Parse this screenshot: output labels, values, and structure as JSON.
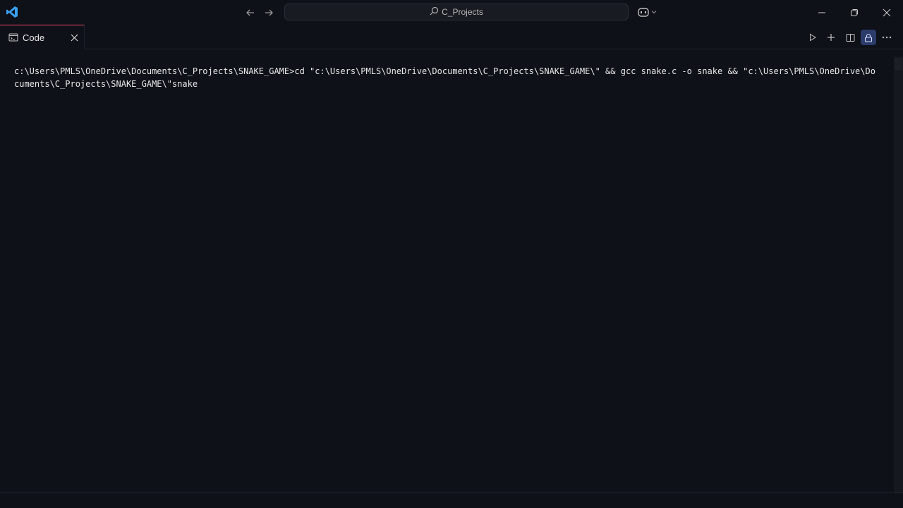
{
  "titlebar": {
    "search_text": "C_Projects",
    "icons": [
      "vscode-logo-icon",
      "arrow-left-icon",
      "arrow-right-icon",
      "search-icon",
      "copilot-icon",
      "minimize-icon",
      "restore-icon",
      "close-icon"
    ]
  },
  "tab": {
    "label": "Code",
    "icon": "terminal-icon"
  },
  "actions": [
    "run-icon",
    "plus-icon",
    "split-icon",
    "lock-icon",
    "ellipsis-icon"
  ],
  "terminal": {
    "line1": "c:\\Users\\PMLS\\OneDrive\\Documents\\C_Projects\\SNAKE_GAME>cd \"c:\\Users\\PMLS\\OneDrive\\Documents\\C_Projects\\SNAKE_GAME\\\" && gcc snake.c -o snake && \"c:\\Users\\PMLS\\OneDrive\\Do",
    "line2": "cuments\\C_Projects\\SNAKE_GAME\\\"snake"
  },
  "colors": {
    "background": "#0e1118",
    "tab_accent": "#f14c6b",
    "lock_active": "#2b3b6a",
    "logo_blue": "#3aa0f0"
  }
}
